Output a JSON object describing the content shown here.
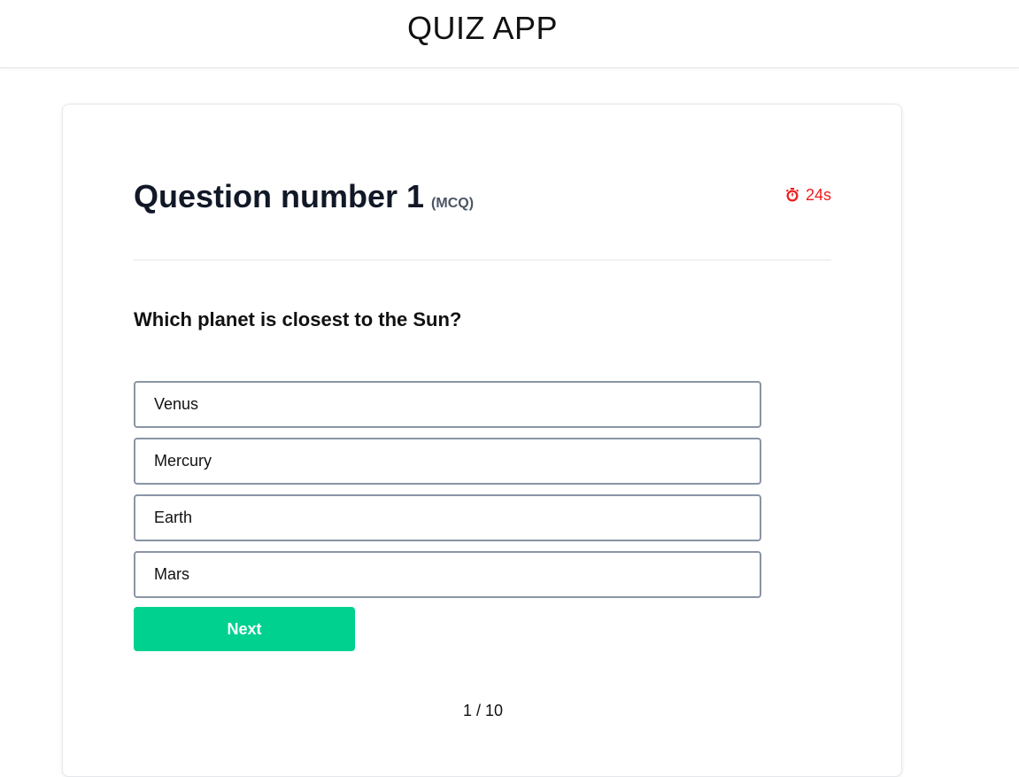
{
  "header": {
    "title": "QUIZ APP"
  },
  "question": {
    "title": "Question number 1",
    "type": "(MCQ)",
    "text": "Which planet is closest to the Sun?",
    "timer": "24s",
    "options": [
      "Venus",
      "Mercury",
      "Earth",
      "Mars"
    ]
  },
  "actions": {
    "next_label": "Next"
  },
  "progress": {
    "label": "1 / 10",
    "current": 1,
    "total": 10
  },
  "colors": {
    "accent": "#00d18f",
    "timer": "#ef1c1c",
    "option_border": "#8a95a5"
  },
  "icons": {
    "timer": "stopwatch-icon"
  }
}
